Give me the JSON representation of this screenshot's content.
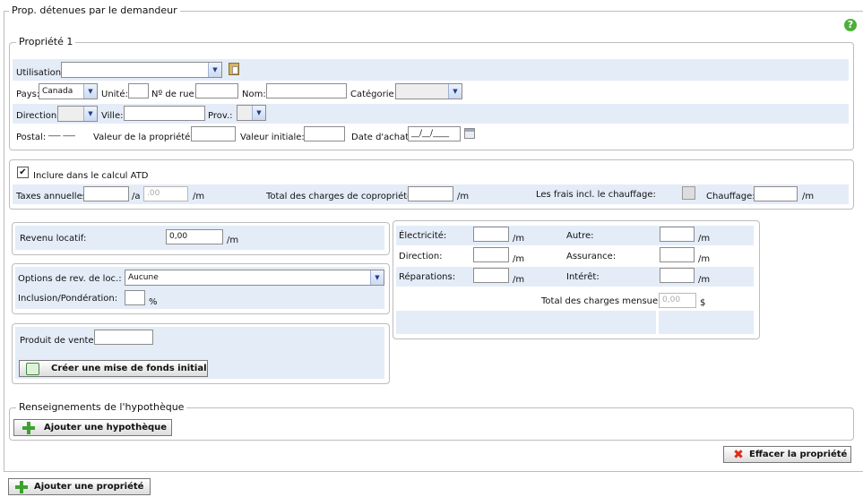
{
  "header": {
    "title": "Prop. détenues par le demandeur",
    "help_icon": "help-icon"
  },
  "property": {
    "title": "Propriété 1",
    "address": {
      "utilisation_label": "Utilisation:",
      "utilisation_value": "",
      "pays_label": "Pays:",
      "pays_value": "Canada",
      "unite_label": "Unité:",
      "no_rue_label": "Nº de rue:",
      "nom_label": "Nom:",
      "categorie_label": "Catégorie:",
      "direction_label": "Direction:",
      "ville_label": "Ville:",
      "prov_label": "Prov.:",
      "postal_label": "Postal:",
      "postal_value": "___ ___",
      "valeur_prop_label": "Valeur de la propriété:",
      "valeur_init_label": "Valeur initiale:",
      "date_achat_label": "Date d'achat:",
      "date_achat_value": "__/__/____"
    },
    "atd": {
      "include_label": "Inclure dans le calcul ATD",
      "include_checked": true,
      "taxes_label": "Taxes annuelles:",
      "per_year": "/a",
      "taxes_month_value": ".00",
      "per_month": "/m",
      "copro_label": "Total des charges de copropriété:",
      "frais_label": "Les frais incl. le chauffage:",
      "chauffage_label": "Chauffage:"
    },
    "revenue": {
      "revenu_label": "Revenu locatif:",
      "revenu_value": "0,00",
      "per_month": "/m",
      "options_label": "Options de rev. de loc.:",
      "options_value": "Aucune",
      "inclusion_label": "Inclusion/Pondération:",
      "percent": "%",
      "produit_label": "Produit de vente:",
      "mise_button": "Créer une mise de fonds initial"
    },
    "charges": {
      "electricite_label": "Électricité:",
      "autre_label": "Autre:",
      "direction_label": "Direction:",
      "assurance_label": "Assurance:",
      "reparations_label": "Réparations:",
      "interet_label": "Intérêt:",
      "per_month": "/m",
      "total_label": "Total des charges mensuelles:",
      "total_value": "0,00",
      "currency": "$"
    },
    "mortgage": {
      "title": "Renseignements de l'hypothèque",
      "add_button": "Ajouter une hypothèque"
    },
    "delete_button": "Effacer la propriété"
  },
  "add_property_button": "Ajouter une propriété",
  "colors": {
    "band": "#e4ecf8",
    "border": "#bdbdbd",
    "accent": "#3da12f",
    "danger": "#d92c1e"
  }
}
